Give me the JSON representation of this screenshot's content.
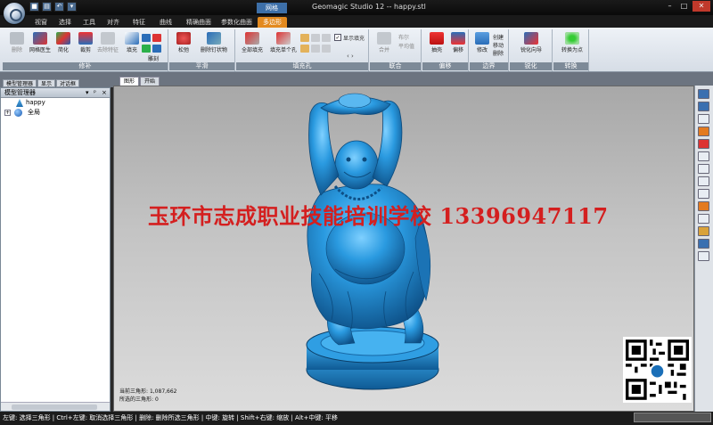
{
  "window": {
    "title": "Geomagic Studio 12 -- happy.stl",
    "context_group": "网格",
    "controls": [
      "–",
      "□",
      "✕"
    ]
  },
  "quick_access": [
    "icon-save",
    "icon-open",
    "icon-undo",
    "icon-dropdown"
  ],
  "ribbon_tabs": [
    {
      "label": "视窗"
    },
    {
      "label": "选择"
    },
    {
      "label": "工具"
    },
    {
      "label": "对齐"
    },
    {
      "label": "特征"
    },
    {
      "label": "曲线"
    },
    {
      "label": "精确曲面"
    },
    {
      "label": "参数化曲面"
    },
    {
      "label": "多边形",
      "active": true
    }
  ],
  "ribbon_groups": [
    {
      "label": "修补",
      "buttons": [
        "删除",
        "网格医生",
        "简化",
        "裁剪",
        "去除特征",
        "填充",
        "雕刻"
      ]
    },
    {
      "label": "平滑",
      "buttons": [
        "松弛",
        "删除钉状物"
      ]
    },
    {
      "label": "填充孔",
      "buttons": [
        "全部填充",
        "填充单个孔",
        "显示填充"
      ]
    },
    {
      "label": "联合",
      "buttons": [
        "合并",
        "布尔",
        "平均值"
      ]
    },
    {
      "label": "偏移",
      "buttons": [
        "抽壳",
        "偏移"
      ]
    },
    {
      "label": "边界",
      "buttons": [
        "修改",
        "创建",
        "移动",
        "删除"
      ]
    },
    {
      "label": "锐化",
      "buttons": [
        "锐化向导"
      ]
    },
    {
      "label": "转换",
      "buttons": [
        "转换为点"
      ]
    }
  ],
  "panel_tabs": [
    "模型管理器",
    "显示",
    "对话框"
  ],
  "model_manager": {
    "header": "模型管理器",
    "items": [
      {
        "label": "happy",
        "icon": "mesh-icon"
      },
      {
        "label": "全局",
        "icon": "globe-icon"
      }
    ]
  },
  "viewport_tabs": [
    "图形",
    "开始"
  ],
  "viewport_info": {
    "current_triangles_label": "当前三角形:",
    "current_triangles": "1,087,662",
    "selected_triangles_label": "所选的三角形:",
    "selected_triangles": "0"
  },
  "watermark": "玉环市志成职业技能培训学校 13396947117",
  "status_bar": "左键: 选择三角形 | Ctrl+左键: 取消选择三角形 | 删除: 删除所选三角形 | 中键: 旋转 | Shift+右键: 缩放 | Alt+中键: 平移",
  "colors": {
    "model": "#2e8fcf",
    "watermark": "#d41f1f",
    "context_tab": "#e38a1f",
    "ribbon_bg": "#e6ebf1"
  }
}
